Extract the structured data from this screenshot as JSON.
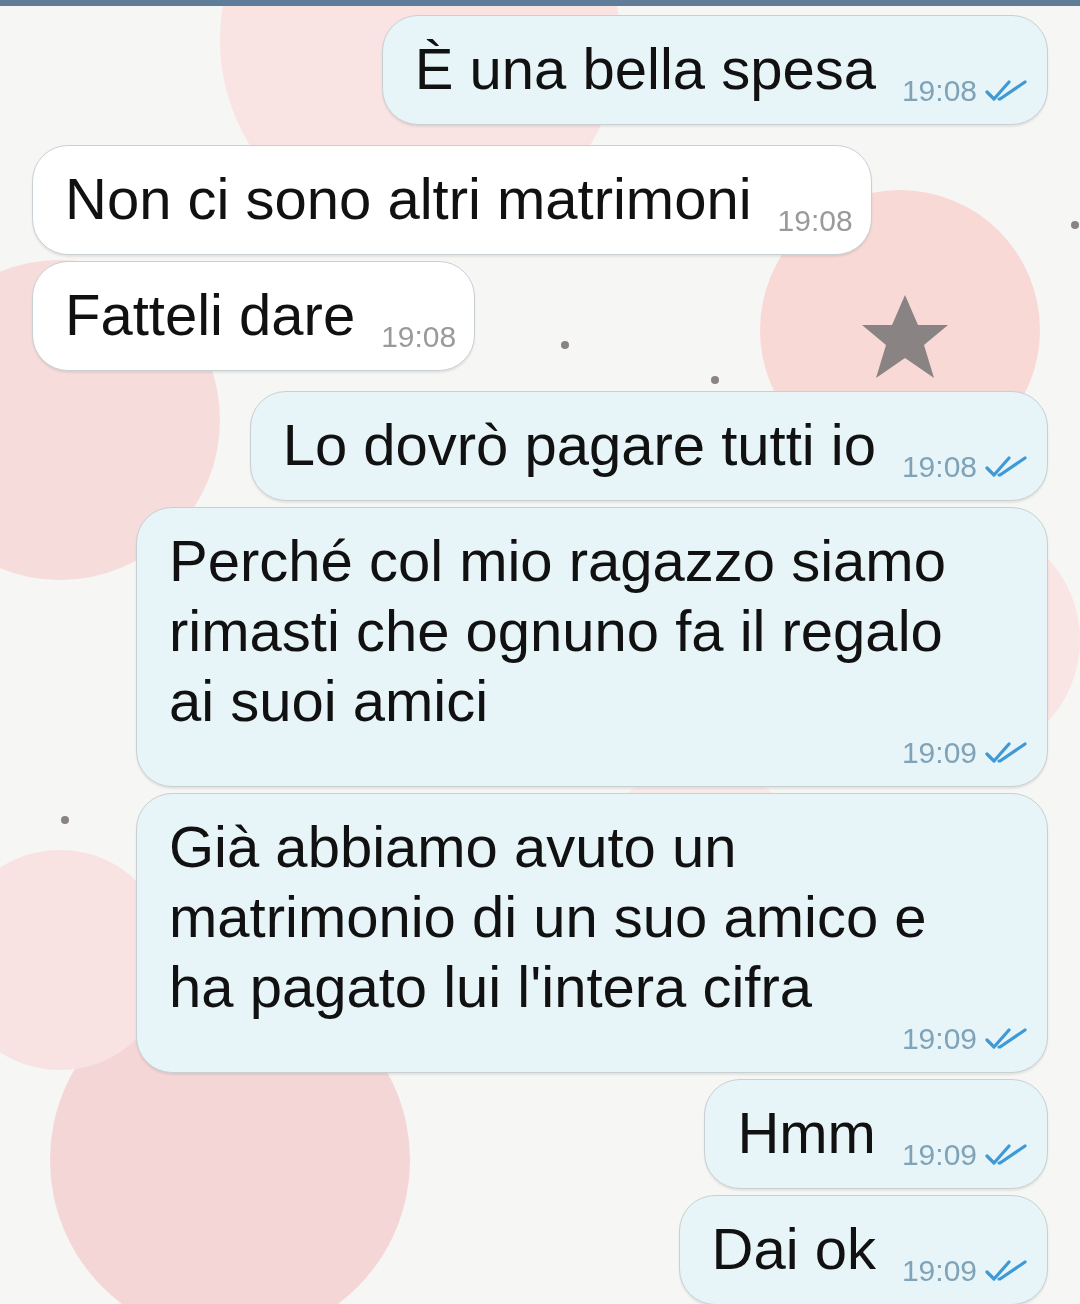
{
  "messages": [
    {
      "kind": "outgoing",
      "text": "È una bella spesa",
      "time": "19:08",
      "read": true
    },
    {
      "kind": "incoming",
      "text": "Non ci sono altri matrimoni",
      "time": "19:08"
    },
    {
      "kind": "incoming",
      "text": "Fatteli dare",
      "time": "19:08"
    },
    {
      "kind": "outgoing",
      "text": "Lo dovrò pagare tutti io",
      "time": "19:08",
      "read": true
    },
    {
      "kind": "outgoing",
      "text": "Perché col mio ragazzo siamo rimasti che ognuno fa il regalo ai suoi amici",
      "time": "19:09",
      "read": true
    },
    {
      "kind": "outgoing",
      "text": "Già abbiamo avuto un matrimonio di un suo amico e ha pagato lui l'intera cifra",
      "time": "19:09",
      "read": true
    },
    {
      "kind": "outgoing",
      "text": "Hmm",
      "time": "19:09",
      "read": true
    },
    {
      "kind": "outgoing",
      "text": "Dai ok",
      "time": "19:09",
      "read": true
    }
  ]
}
